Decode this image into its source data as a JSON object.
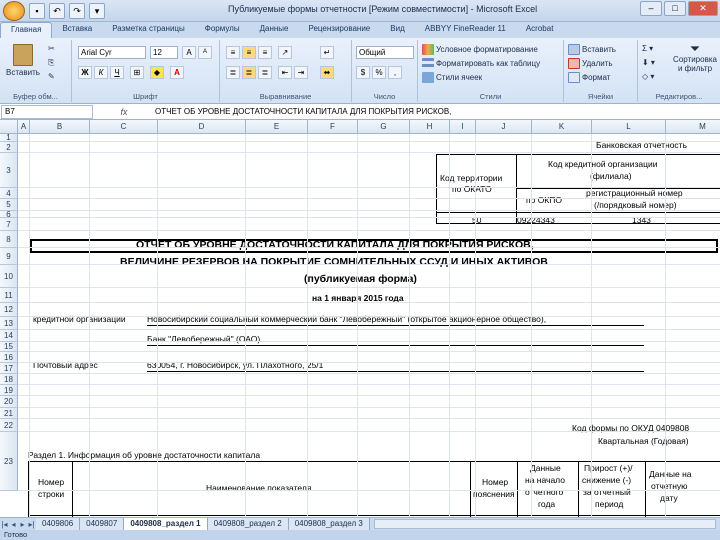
{
  "window": {
    "title": "Публикуемые формы отчетности  [Режим совместимости] - Microsoft Excel"
  },
  "ribbon_tabs": [
    {
      "label": "Главная"
    },
    {
      "label": "Вставка"
    },
    {
      "label": "Разметка страницы"
    },
    {
      "label": "Формулы"
    },
    {
      "label": "Данные"
    },
    {
      "label": "Рецензирование"
    },
    {
      "label": "Вид"
    },
    {
      "label": "ABBYY FineReader 11"
    },
    {
      "label": "Acrobat"
    }
  ],
  "ribbon": {
    "clipboard": {
      "paste": "Вставить",
      "group": "Буфер обм..."
    },
    "font": {
      "name": "Arial Cyr",
      "size": "12",
      "bold": "Ж",
      "italic": "К",
      "underline": "Ч",
      "grow": "A",
      "shrink": "A",
      "color": "A",
      "group": "Шрифт"
    },
    "alignment": {
      "group": "Выравнивание"
    },
    "number": {
      "format": "Общий",
      "group": "Число"
    },
    "styles": {
      "conditional": "Условное форматирование",
      "table": "Форматировать как таблицу",
      "cell_styles": "Стили ячеек",
      "group": "Стили"
    },
    "cells": {
      "insert": "Вставить",
      "delete": "Удалить",
      "format": "Формат",
      "group": "Ячейки"
    },
    "editing": {
      "sort": "Сортировка и фильтр",
      "group": "Редактиров..."
    }
  },
  "formula_bar": {
    "name_box": "B7",
    "fx": "fx",
    "formula": "ОТЧЕТ ОБ УРОВНЕ ДОСТАТОЧНОСТИ КАПИТАЛА ДЛЯ ПОКРЫТИЯ РИСКОВ,"
  },
  "columns": [
    "A",
    "B",
    "C",
    "D",
    "E",
    "F",
    "G",
    "H",
    "I",
    "J",
    "K",
    "L",
    "M"
  ],
  "rows": [
    "1",
    "2",
    "3",
    "4",
    "5",
    "6",
    "7",
    "8",
    "9",
    "10",
    "11",
    "12",
    "13",
    "14",
    "15",
    "16",
    "17",
    "18",
    "19",
    "20",
    "21",
    "22",
    "23"
  ],
  "cells": {
    "bank_report": "Банковская отчетность",
    "territory_code": "Код территории",
    "okato": "по ОКАТО",
    "org_code": "Код кредитной организации",
    "branch": "(филиала)",
    "okpo_label": "по ОКПО",
    "reg_number": "регистрационный номер",
    "ordinal": "(/порядковый номер)",
    "okato_value": "50",
    "okpo_value": "09224343",
    "reg_value": "1343",
    "title1": "ОТЧЕТ ОБ УРОВНЕ ДОСТАТОЧНОСТИ КАПИТАЛА ДЛЯ ПОКРЫТИЯ РИСКОВ,",
    "title2": "ВЕЛИЧИНЕ РЕЗЕРВОВ НА ПОКРЫТИЕ СОМНИТЕЛЬНЫХ ССУД И ИНЫХ АКТИВОВ",
    "title3": "(публикуемая форма)",
    "title4": "на 1 января 2015 года",
    "org_label": "кредитной организации",
    "org_name": "Новосибирский социальный коммерческий банк \"Левобережный\" (открытое акционерное общество),",
    "org_short": "Банк \"Левобережный\" (ОАО)",
    "address_label": "Почтовый адрес",
    "address": "630054, г. Новосибирск, ул. Плахотного, 25/1",
    "okud": "Код формы по ОКУД 0409808",
    "period": "Квартальная (Годовая)",
    "section1": "Раздел 1. Информация об уровне достаточности капитала",
    "h_num": "Номер",
    "h_row": "строки",
    "h_name": "Наименование показателя",
    "h_expl1": "Номер",
    "h_expl2": "пояснения",
    "h_data1": "Данные",
    "h_data2": "на начало",
    "h_data3": "отчетного",
    "h_data4": "года",
    "h_inc1": "Прирост (+)/",
    "h_inc2": "снижение (-)",
    "h_inc3": "за отчетный",
    "h_inc4": "период",
    "h_rep1": "Данные на",
    "h_rep2": "отчетную",
    "h_rep3": "дату"
  },
  "sheet_tabs": [
    {
      "label": "0409806"
    },
    {
      "label": "0409807"
    },
    {
      "label": "0409808_раздел 1"
    },
    {
      "label": "0409808_раздел 2"
    },
    {
      "label": "0409808_раздел 3"
    }
  ],
  "status": "Готово"
}
